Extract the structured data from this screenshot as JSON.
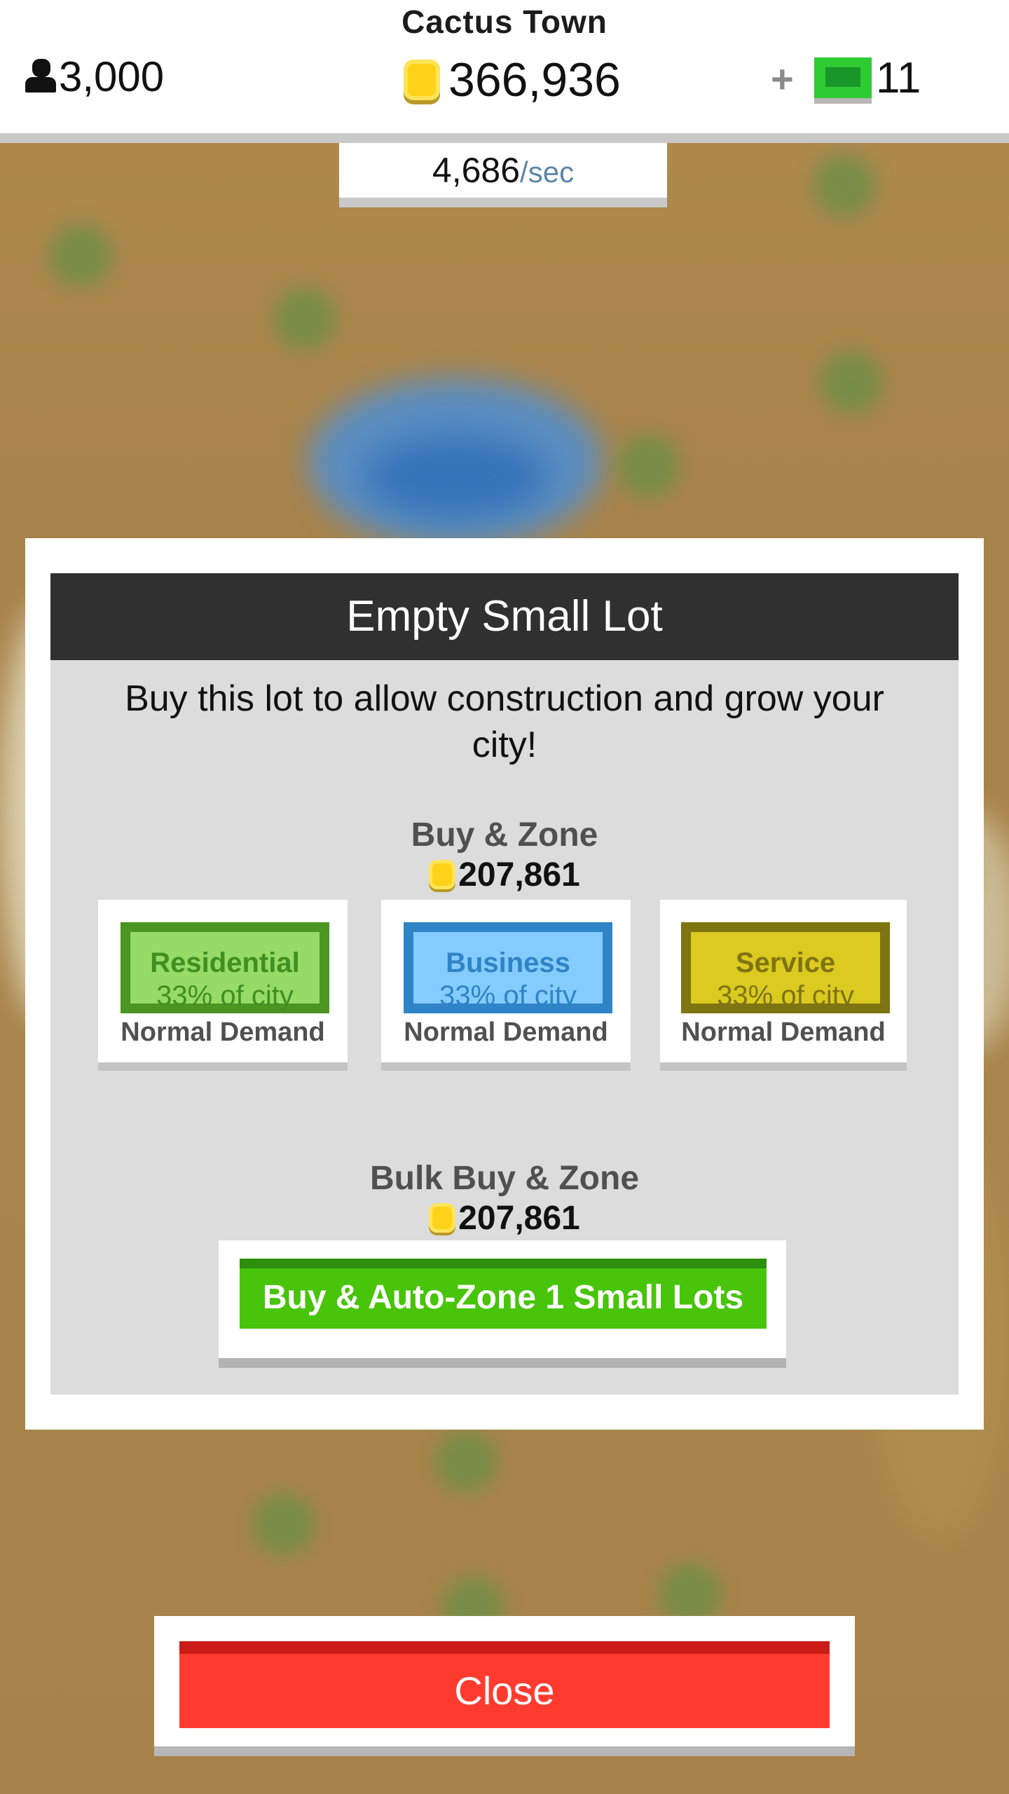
{
  "header": {
    "city_name": "Cactus Town",
    "population": "3,000",
    "coins": "366,936",
    "bills_plus": "+",
    "bills": "11",
    "rate_value": "4,686",
    "rate_unit": "/sec"
  },
  "icons": {
    "population": "person-icon",
    "coins": "coin-icon",
    "bills": "cash-bill-icon"
  },
  "modal": {
    "title": "Empty Small Lot",
    "description": "Buy this lot to allow construction and grow your city!",
    "buy_zone": {
      "label": "Buy & Zone",
      "price": "207,861",
      "zones": [
        {
          "label": "Residential",
          "share": "33% of city",
          "demand": "Normal Demand"
        },
        {
          "label": "Business",
          "share": "33% of city",
          "demand": "Normal Demand"
        },
        {
          "label": "Service",
          "share": "33% of city",
          "demand": "Normal Demand"
        }
      ]
    },
    "bulk": {
      "label": "Bulk Buy & Zone",
      "price": "207,861",
      "button_label": "Buy & Auto-Zone 1 Small Lots"
    }
  },
  "close_label": "Close",
  "colors": {
    "residential": "#96db67",
    "business": "#84ccff",
    "service": "#dbca1f",
    "bulk_button": "#48c40a",
    "close_button": "#ff3b30"
  }
}
